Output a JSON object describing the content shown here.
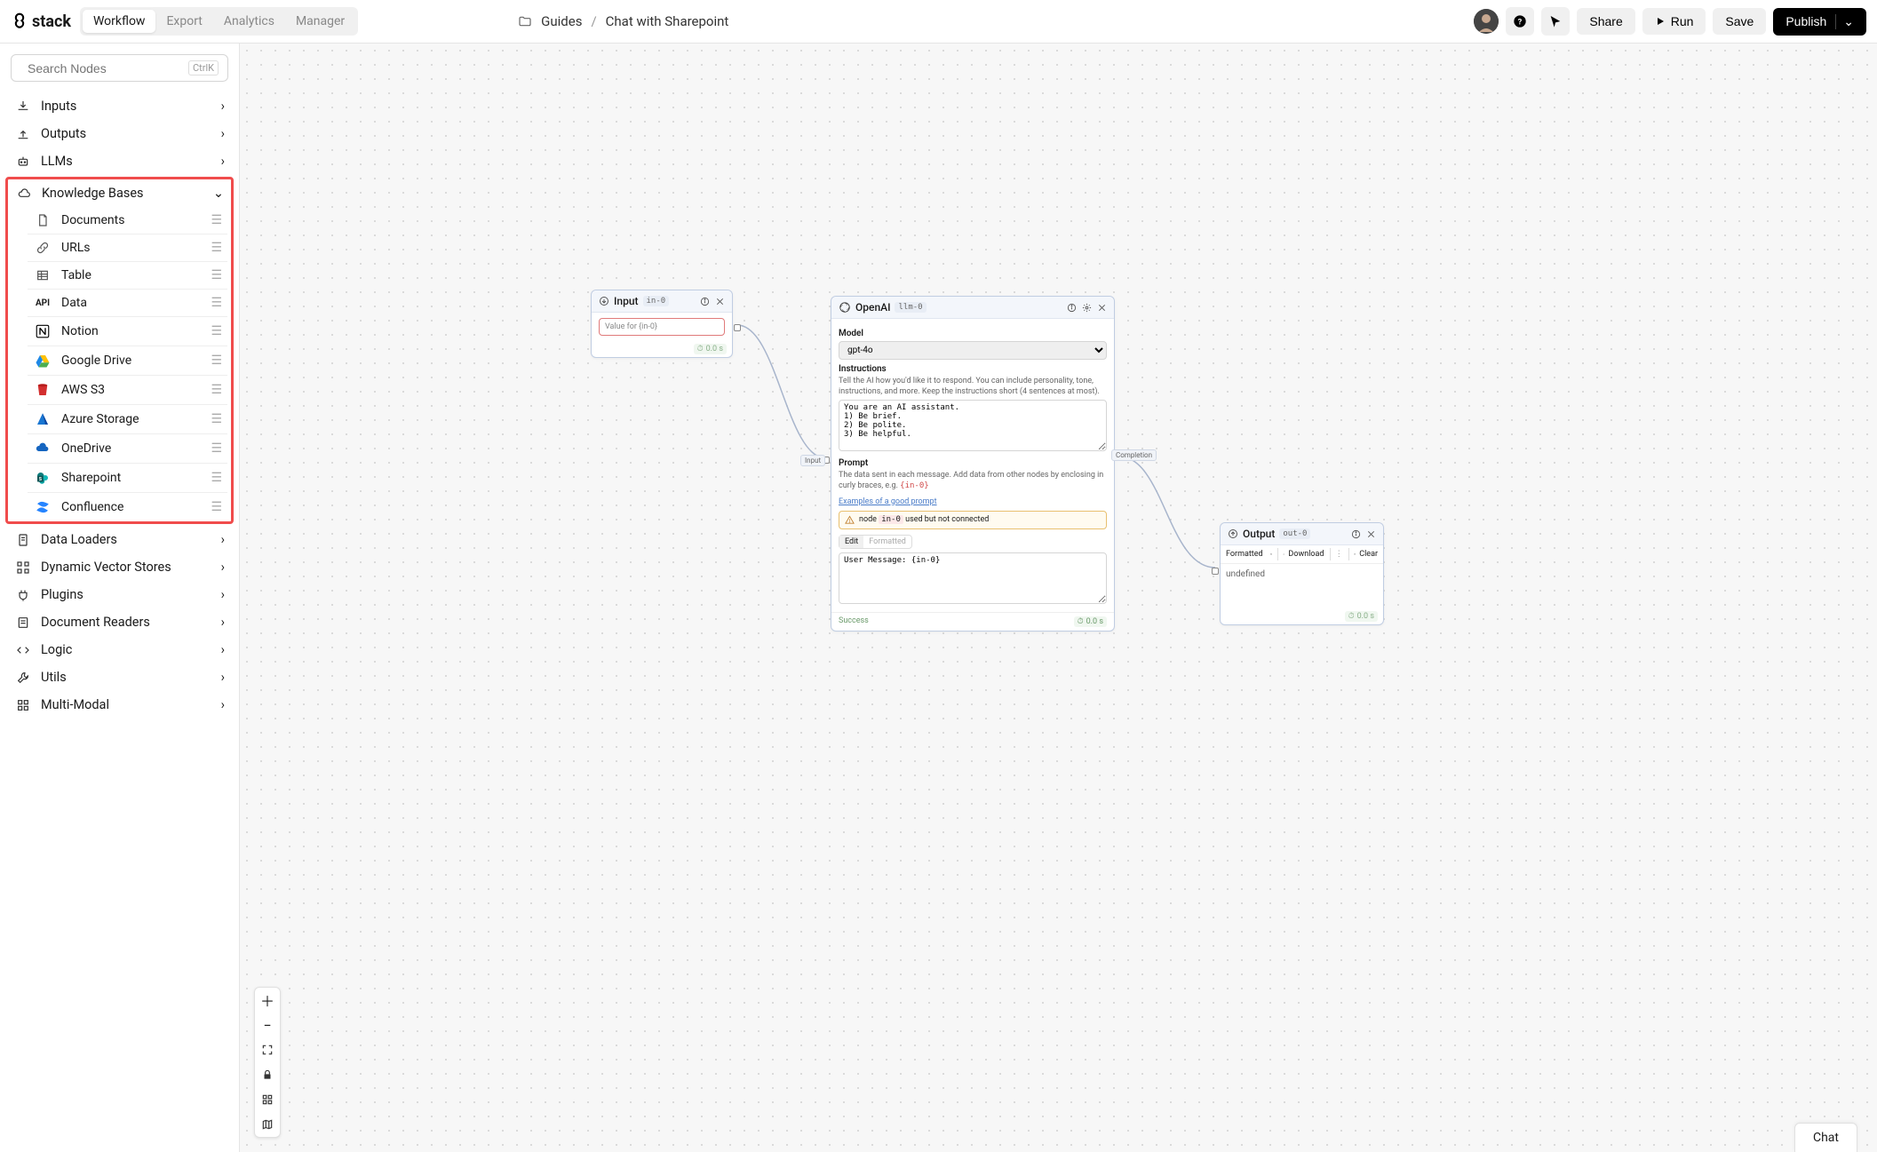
{
  "header": {
    "logo_text": "stack",
    "tabs": [
      "Workflow",
      "Export",
      "Analytics",
      "Manager"
    ],
    "active_tab": 0,
    "breadcrumb": {
      "folder": "Guides",
      "page": "Chat with Sharepoint"
    },
    "share": "Share",
    "run": "Run",
    "save": "Save",
    "publish": "Publish"
  },
  "search": {
    "placeholder": "Search Nodes",
    "shortcut": "CtrlK"
  },
  "categories": [
    {
      "name": "Inputs"
    },
    {
      "name": "Outputs"
    },
    {
      "name": "LLMs"
    },
    {
      "name": "Knowledge Bases",
      "expanded": true,
      "highlighted": true,
      "items": [
        "Documents",
        "URLs",
        "Table",
        "Data",
        "Notion",
        "Google Drive",
        "AWS S3",
        "Azure Storage",
        "OneDrive",
        "Sharepoint",
        "Confluence"
      ]
    },
    {
      "name": "Data Loaders"
    },
    {
      "name": "Dynamic Vector Stores"
    },
    {
      "name": "Plugins"
    },
    {
      "name": "Document Readers"
    },
    {
      "name": "Logic"
    },
    {
      "name": "Utils"
    },
    {
      "name": "Multi-Modal"
    }
  ],
  "nodes": {
    "input": {
      "title": "Input",
      "id": "in-0",
      "placeholder": "Value for {in-0}",
      "timing": "0.0 s"
    },
    "openai": {
      "title": "OpenAI",
      "id": "llm-0",
      "model_label": "Model",
      "model_value": "gpt-4o",
      "instructions_label": "Instructions",
      "instructions_desc": "Tell the AI how you'd like it to respond. You can include personality, tone, instructions, and more. Keep the instructions short (4 sentences at most).",
      "instructions_value": "You are an AI assistant.\n1) Be brief.\n2) Be polite.\n3) Be helpful.",
      "prompt_label": "Prompt",
      "prompt_desc_pre": "The data sent in each message. Add data from other nodes by enclosing in curly braces, e.g. ",
      "prompt_desc_code": "{in-0}",
      "prompt_link": "Examples of a good prompt",
      "warn_pre": "node",
      "warn_code": "in-0",
      "warn_post": "used but not connected",
      "seg_edit": "Edit",
      "seg_formatted": "Formatted",
      "prompt_value_pre": "User Message: ",
      "prompt_value_var": "{in-0}",
      "status": "Success",
      "timing": "0.0 s",
      "port_in": "Input",
      "port_out": "Completion"
    },
    "output": {
      "title": "Output",
      "id": "out-0",
      "tb_formatted": "Formatted",
      "tb_download": "Download",
      "tb_clear": "Clear",
      "content": "undefined",
      "timing": "0.0 s"
    }
  },
  "chat_label": "Chat"
}
